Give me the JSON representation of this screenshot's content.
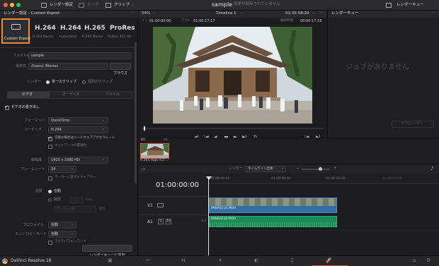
{
  "topbar": {
    "render_settings": "レンダー設定",
    "tape": "テープ",
    "clip": "クリップ",
    "project_title": "sample",
    "unsaved": "変更が保存されていません",
    "render_queue": "レンダーキュー"
  },
  "panel": {
    "header": "レンダー設定 - Custom Export",
    "presets": [
      {
        "label": "Custom Export"
      },
      {
        "big": "H.264",
        "label": "H.264 Master"
      },
      {
        "big": "H.264",
        "label": "HyperDeck"
      },
      {
        "big": "H.265",
        "label": "H.265 Master"
      },
      {
        "big": "ProRes",
        "label": "ProRes 422 HQ"
      }
    ],
    "filename_label": "ファイル名",
    "filename": "sample",
    "location_label": "保存先",
    "location": "/Users/       /Movies",
    "browse": "ブラウズ",
    "render_label": "レンダー",
    "single_clip": "単一のクリップ",
    "individual_clips": "個別のクリップ",
    "tabs": [
      "ビデオ",
      "オーディオ",
      "ファイル"
    ],
    "export_video": "ビデオの書き出し",
    "format_label": "フォーマット",
    "format": "QuickTime",
    "codec_label": "コーデック",
    "codec": "H.264",
    "hw_accel": "可能な場合はハードウェアアクセラレート",
    "network_opt": "ネットワークの最適化",
    "resolution_label": "解像度",
    "resolution": "1920 x 1080 HD",
    "framerate_label": "フレームレート",
    "framerate": "24",
    "chapter_marker": "マーカーに基づくチャプター",
    "quality_label": "品質",
    "auto": "自動",
    "restrict": "制限",
    "kbps": "Kb/s",
    "best": "最高",
    "data_level": "データレベル",
    "profile_label": "プロファイル",
    "profile": "自動",
    "entropy_label": "エントロピーモード",
    "entropy": "自動",
    "multipass": "マルチパスエンコード",
    "add_queue": "レンダーキューに追加"
  },
  "viewer": {
    "zoom": "54%",
    "timeline": "Timeline 1",
    "timecode": "01:35:58:20",
    "in_label": "イン",
    "in": "01:00:00:00",
    "out_label": "アウト",
    "out": "01:00:17:17",
    "dur_label": "継続時間",
    "dur": "00:00:17:18"
  },
  "queue": {
    "title": "レンダーキュー",
    "empty": "ジョブがありません",
    "render_all": "すべてレンダー"
  },
  "clips": {
    "number": "01",
    "track": "V1",
    "clip_label": "H.264 High 4:2:..."
  },
  "timeline": {
    "render_label": "レンダー",
    "range": "タイムライン全体",
    "tc": "01:00:00:00",
    "ruler": [
      "01:00:00:00",
      "01:00:08:00",
      "01:00:16:00",
      "01:00:24:00"
    ],
    "v1": "V1",
    "a1": "A1",
    "a_s": "S",
    "a_m": "M",
    "a_vol": "2.0",
    "video_clip": "PANA0210.MOV",
    "audio_clip": "PANA0210.MOV"
  },
  "footer": {
    "app": "DaVinci Resolve 18"
  }
}
